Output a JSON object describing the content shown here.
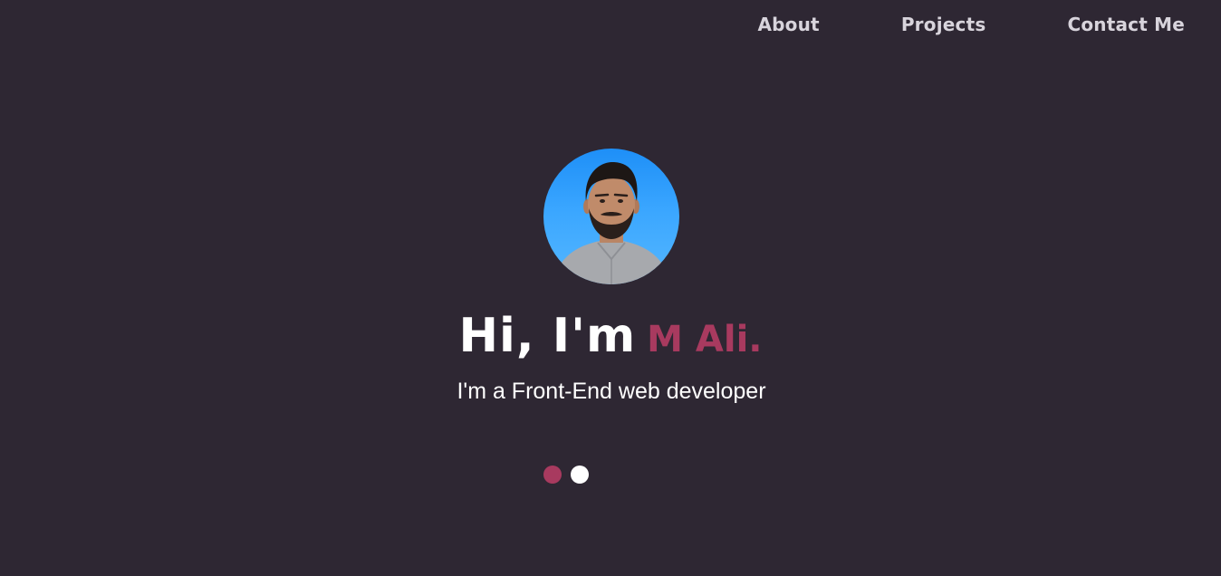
{
  "nav": {
    "items": [
      {
        "label": "About"
      },
      {
        "label": "Projects"
      },
      {
        "label": "Contact Me"
      }
    ]
  },
  "hero": {
    "greeting": "Hi, I'm",
    "name": "M Ali.",
    "subtitle": "I'm a Front-End web developer"
  },
  "colors": {
    "background": "#2e2733",
    "accent": "#a83a5f",
    "text": "#ffffff",
    "avatar_bg": "#3aa6ff"
  },
  "carousel": {
    "dots": [
      {
        "color": "#a83a5f",
        "active": true
      },
      {
        "color": "#ffffff",
        "active": false
      }
    ]
  }
}
